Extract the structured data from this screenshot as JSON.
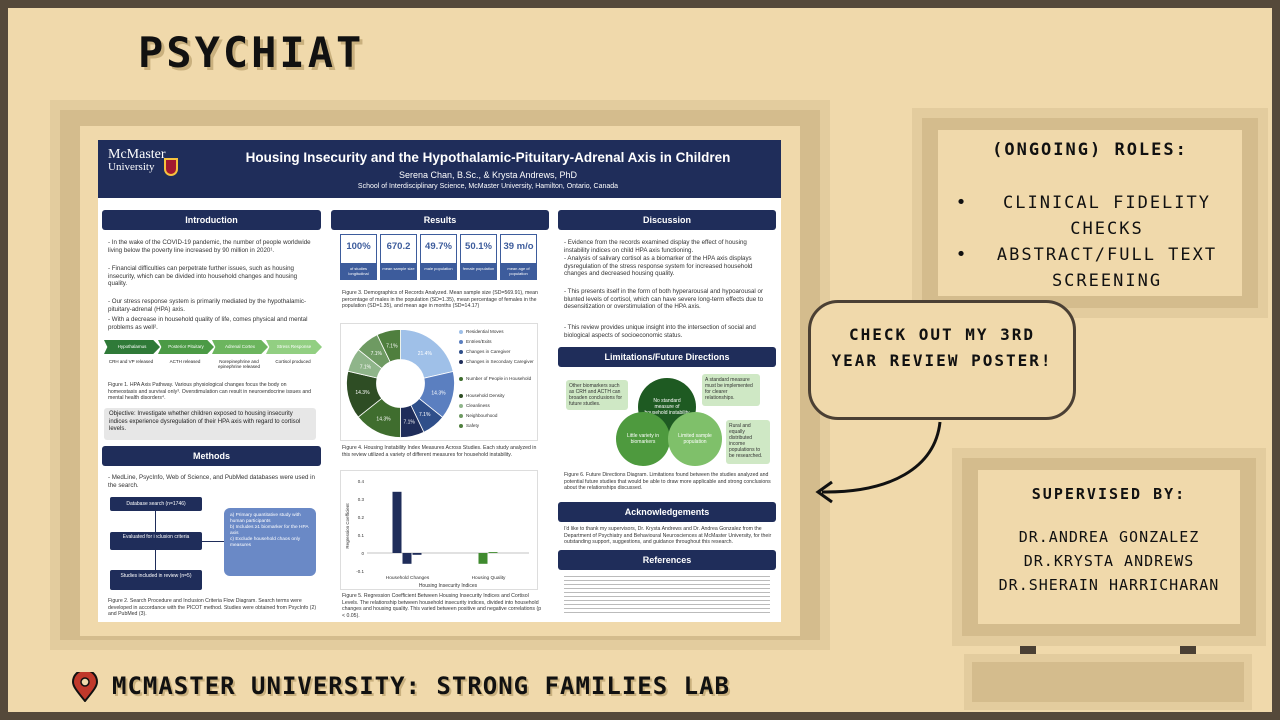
{
  "page": {
    "title": "PSYCHIAT",
    "footer": "MCMASTER UNIVERSITY: STRONG FAMILIES LAB"
  },
  "roles": {
    "heading": "(ONGOING) ROLES:",
    "items": [
      "CLINICAL FIDELITY CHECKS",
      "ABSTRACT/FULL TEXT SCREENING"
    ]
  },
  "callout": "CHECK OUT MY 3RD YEAR REVIEW POSTER!",
  "supervisors": {
    "heading": "SUPERVISED BY:",
    "names": [
      "DR.ANDREA GONZALEZ",
      "DR.KRYSTA ANDREWS",
      "DR.SHERAIN HARRICHARAN"
    ]
  },
  "poster": {
    "logo_line1": "McMaster",
    "logo_line2": "University",
    "title": "Housing Insecurity and the Hypothalamic-Pituitary-Adrenal Axis in Children",
    "authors": "Serena Chan, B.Sc., & Krysta Andrews, PhD",
    "school": "School of Interdisciplinary Science, McMaster University, Hamilton, Ontario, Canada",
    "sections": {
      "introduction": "Introduction",
      "results": "Results",
      "discussion": "Discussion",
      "methods": "Methods",
      "limitations": "Limitations/Future Directions",
      "acknowledgements": "Acknowledgements",
      "references": "References"
    },
    "intro_text": [
      "- In the wake of the COVID-19 pandemic, the number of people worldwide living below the poverty line increased by 90 million in 2020¹.",
      "- Financial difficulties can perpetrate further issues, such as housing insecurity, which can be divided into household changes and housing quality.",
      "- Our stress response system is primarily mediated by the hypothalamic-pituitary-adrenal (HPA) axis.",
      "- With a decrease in household quality of life, comes physical and mental problems as well²."
    ],
    "hpa_steps": [
      "Hypothalamus",
      "Posterior Pituitary",
      "Adrenal Cortex",
      "Stress Response"
    ],
    "hpa_labels": [
      "CRH and VP released",
      "ACTH released",
      "Norepinephrine and epinephrine released",
      "Cortisol produced"
    ],
    "fig1_caption": "Figure 1. HPA Axis Pathway. Various physiological changes focus the body on homeostasis and survival only³. Overstimulation can result in neuroendocrine issues and mental health disorders⁴.",
    "objective": "Objective: Investigate whether children exposed to housing insecurity indices experience dysregulation of their HPA axis with regard to cortisol levels.",
    "methods_text": "- MedLine, PsycInfo, Web of Science, and PubMed databases were used in the search.",
    "flow": [
      "Database search (n=1746)",
      "Evaluated for inclusion criteria",
      "Studies included in review (n=5)"
    ],
    "inclusion": [
      "a) Primary quantitative study with human participants",
      "b) Includes ≥1 biomarker for the HPA axis",
      "c) Exclude household chaos only measures"
    ],
    "fig2_caption": "Figure 2. Search Procedure and Inclusion Criteria Flow Diagram. Search terms were developed in accordance with the PICOT method. Studies were obtained from PsycInfo (2) and PubMed (3).",
    "stats": [
      {
        "value": "100%",
        "label": "of studies longitudinal"
      },
      {
        "value": "670.2",
        "label": "mean sample size"
      },
      {
        "value": "49.7%",
        "label": "male population"
      },
      {
        "value": "50.1%",
        "label": "female population"
      },
      {
        "value": "39 m/o",
        "label": "mean age of population"
      }
    ],
    "fig3_caption": "Figure 3. Demographics of Records Analyzed. Mean sample size (SD=569.91), mean percentage of males in the population (SD=1.35), mean percentage of females in the population (SD=1.35), and mean age in months (SD=14.17)",
    "pie_legend": [
      "Residential Moves",
      "Entries/Exits",
      "Changes in Caregiver",
      "Changes in Secondary Caregiver",
      "Number of People in Household",
      "Household Density",
      "Cleanliness",
      "Neighbourhood",
      "Safety"
    ],
    "pie_colors": [
      "#9fc0e8",
      "#5b7fc0",
      "#2f4f8a",
      "#1f2d5a",
      "#3f6d2e",
      "#2e4d24",
      "#8fb58a",
      "#6e9a62",
      "#4f7f3e"
    ],
    "fig4_caption": "Figure 4. Housing Instability Index Measures Across Studies. Each study analyzed in this review utilized a variety of different measures for household instability.",
    "fig5_caption": "Figure 5. Regression Coefficient Between Housing Insecurity Indices and Cortisol Levels. The relationship between household insecurity indices, divided into household changes and housing quality. This varied between positive and negative correlations (p < 0.05).",
    "discussion_text": [
      "- Evidence from the records examined display the effect of housing instability indices on child HPA axis functioning.",
      "- Analysis of salivary cortisol as a biomarker of the HPA axis displays dysregulation of the stress response system for increased household changes and decreased housing quality.",
      "- This presents itself in the form of both hyperarousal and hypoarousal or blunted levels of cortisol, which can have severe long-term effects due to desensitization or overstimulation of the HPA axis.",
      "- This review provides unique insight into the intersection of social and biological aspects of socioeconomic status."
    ],
    "future_boxes": [
      "Other biomarkers such as CRH and ACTH can broaden conclusions for future studies.",
      "A standard measure must be implemented for clearer relationships.",
      "Rural and equally distributed income populations to be researched."
    ],
    "future_circles": [
      "No standard measure of household instability",
      "Little variety in biomarkers",
      "Limited sample population"
    ],
    "fig6_caption": "Figure 6. Future Directions Diagram. Limitations found between the studies analyzed and potential future studies that would be able to draw more applicable and strong conclusions about the relationships discussed.",
    "ack_text": "I'd like to thank my supervisors, Dr. Krysta Andrews and Dr. Andrea Gonzalez from the Department of Psychiatry and Behavioural Neurosciences at McMaster University, for their outstanding support, suggestions, and guidance throughout this research."
  },
  "chart_data": [
    {
      "type": "pie",
      "title": "",
      "categories": [
        "Residential Moves",
        "Entries/Exits",
        "Changes in Caregiver",
        "Changes in Secondary Caregiver",
        "Number of People in Household",
        "Household Density",
        "Cleanliness",
        "Neighbourhood",
        "Safety"
      ],
      "values": [
        21.4,
        14.3,
        7.1,
        7.1,
        14.3,
        14.3,
        7.1,
        7.1,
        7.1
      ],
      "colors": [
        "#9fc0e8",
        "#5b7fc0",
        "#2f4f8a",
        "#1f2d5a",
        "#3f6d2e",
        "#2e4d24",
        "#8fb58a",
        "#6e9a62",
        "#4f7f3e"
      ],
      "labels": [
        "21.4%",
        "14.3%",
        "7.1%",
        "7.1%",
        "14.3%",
        "14.3%",
        "7.1%",
        "7.1%",
        "7.1%"
      ]
    },
    {
      "type": "bar",
      "xlabel": "Housing Insecurity Indices",
      "ylabel": "Regression Coefficient",
      "categories": [
        "Household Changes",
        "Housing Quality"
      ],
      "ylim": [
        -0.1,
        0.4
      ],
      "yticks": [
        "0.4",
        "0.3",
        "0.2",
        "0.1",
        "0",
        "-0.1"
      ],
      "series_values": [
        [
          0.34,
          -0.06,
          -0.01
        ],
        [
          -0.06,
          0.005
        ]
      ],
      "series_colors": [
        [
          "#1f2d5a",
          "#1f2d5a",
          "#1f2d5a"
        ],
        [
          "#3f8a2e",
          "#3f8a2e"
        ]
      ]
    }
  ]
}
